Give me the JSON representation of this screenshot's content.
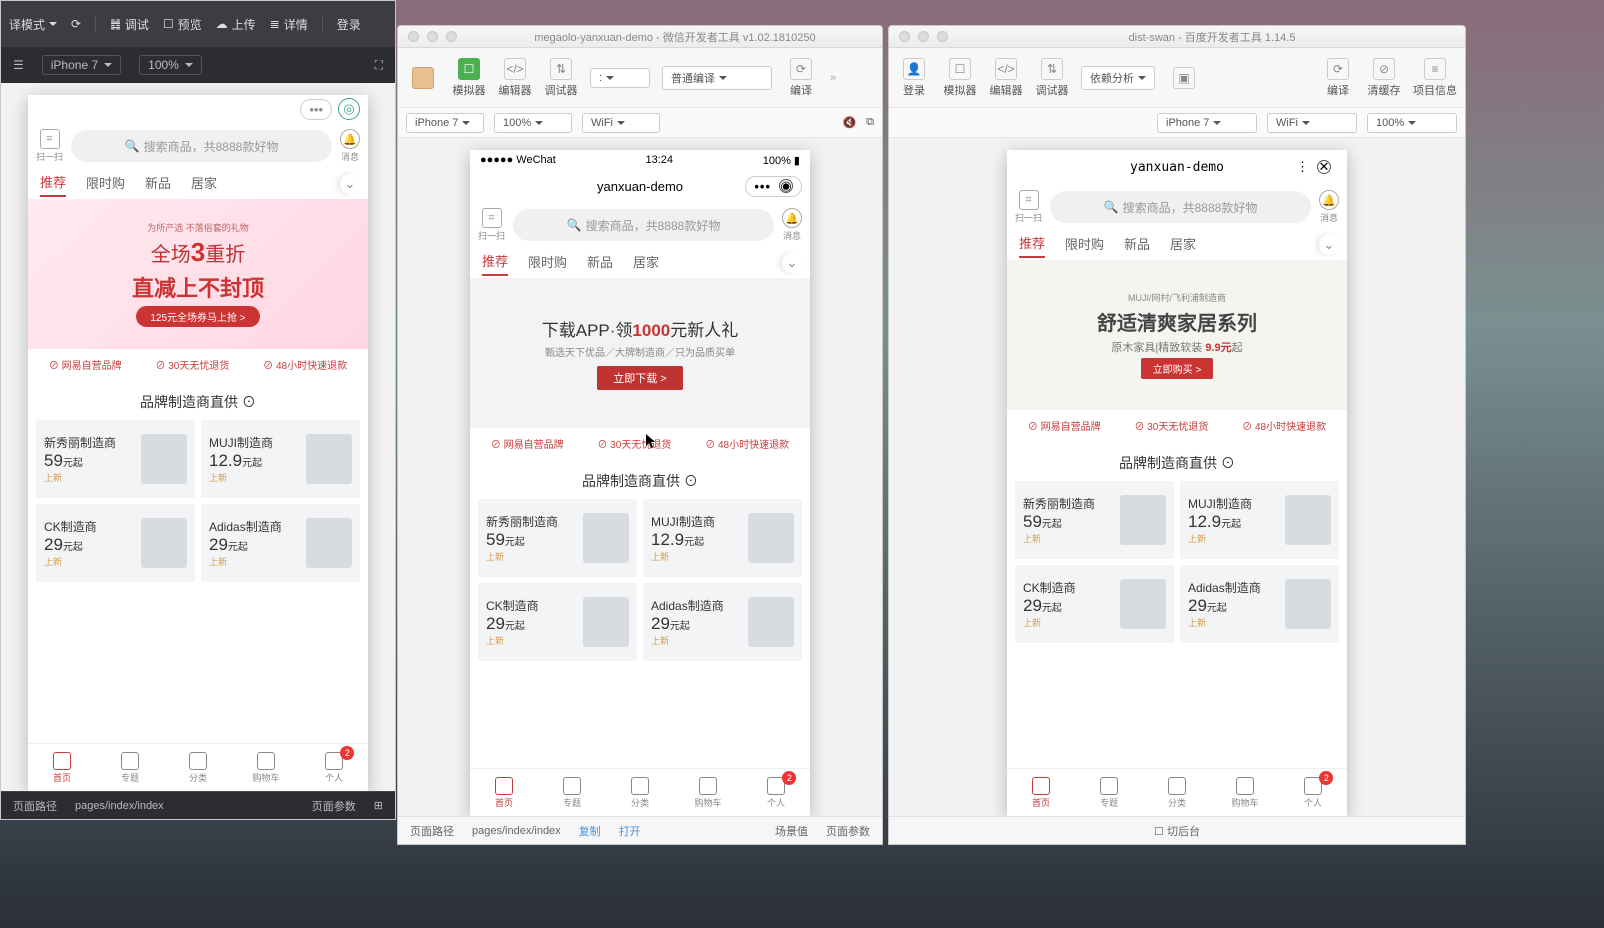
{
  "win1": {
    "toolbar": {
      "interpret": "译模式",
      "debug": "调试",
      "preview": "预览",
      "upload": "上传",
      "detail": "详情",
      "login": "登录"
    },
    "sub": {
      "device": "iPhone 7",
      "zoom": "100%"
    },
    "bottom": {
      "pathlabel": "页面路径",
      "path": "pages/index/index",
      "params": "页面参数"
    }
  },
  "win2": {
    "title": "megaolo-yanxuan-demo - 微信开发者工具 v1.02.1810250",
    "tb": {
      "sim": "模拟器",
      "edit": "编辑器",
      "dbg": "调试器",
      "compile": "普通编译",
      "compile_action": "编译"
    },
    "sub": {
      "device": "iPhone 7",
      "zoom": "100%",
      "net": "WiFi"
    },
    "bottom": {
      "pathlabel": "页面路径",
      "path": "pages/index/index",
      "copy": "复制",
      "open": "打开",
      "scene": "场景值",
      "params": "页面参数"
    }
  },
  "win3": {
    "title": "dist-swan - 百度开发者工具 1.14.5",
    "tb": {
      "login": "登录",
      "sim": "模拟器",
      "edit": "编辑器",
      "dbg": "调试器",
      "dep": "依赖分析",
      "compile": "编译",
      "clear": "清缓存",
      "info": "项目信息"
    },
    "sub": {
      "device": "iPhone 7",
      "net": "WiFi",
      "zoom": "100%"
    },
    "bottom": {
      "backend": "切后台"
    }
  },
  "phone_common": {
    "scan": "扫一扫",
    "bell": "消息",
    "search_placeholder": "搜索商品，共8888款好物",
    "tabs": [
      "推荐",
      "限时购",
      "新品",
      "居家"
    ],
    "badges": [
      "网易自营品牌",
      "30天无忧退货",
      "48小时快速退款"
    ],
    "section_title": "品牌制造商直供",
    "products": [
      {
        "name": "新秀丽制造商",
        "price": "59",
        "unit": "元起",
        "tag": "上新"
      },
      {
        "name": "MUJI制造商",
        "price": "12.9",
        "unit": "元起",
        "tag": "上新"
      },
      {
        "name": "CK制造商",
        "price": "29",
        "unit": "元起",
        "tag": "上新"
      },
      {
        "name": "Adidas制造商",
        "price": "29",
        "unit": "元起",
        "tag": "上新"
      }
    ],
    "tabbar": [
      {
        "label": "首页"
      },
      {
        "label": "专题"
      },
      {
        "label": "分类"
      },
      {
        "label": "购物车"
      },
      {
        "label": "个人",
        "badge": "2"
      }
    ]
  },
  "phone2": {
    "status_left": "●●●●● WeChat",
    "status_time": "13:24",
    "status_right": "100%",
    "nav_title": "yanxuan-demo",
    "banner_line1_a": "下载APP·领",
    "banner_line1_b": "1000",
    "banner_line1_c": "元新人礼",
    "banner_line2": "甄选天下优品／大牌制造商／只为品质买单",
    "banner_btn": "立即下载 >"
  },
  "phone1": {
    "banner_sub": "为所产选 不落俗套的礼物",
    "banner_l1a": "全场",
    "banner_l1b": "3",
    "banner_l1c": "重折",
    "banner_l2": "直减上不封顶",
    "banner_pill": "125元全场券马上抢 >"
  },
  "phone3": {
    "nav_title": "yanxuan-demo",
    "banner_top": "MUJI/网村/飞利浦制造商",
    "banner_l1": "舒适清爽家居系列",
    "banner_l2a": "原木家具|精致软装 ",
    "banner_l2b": "9.9元",
    "banner_l2c": "起",
    "banner_pill": "立即购买 >"
  }
}
